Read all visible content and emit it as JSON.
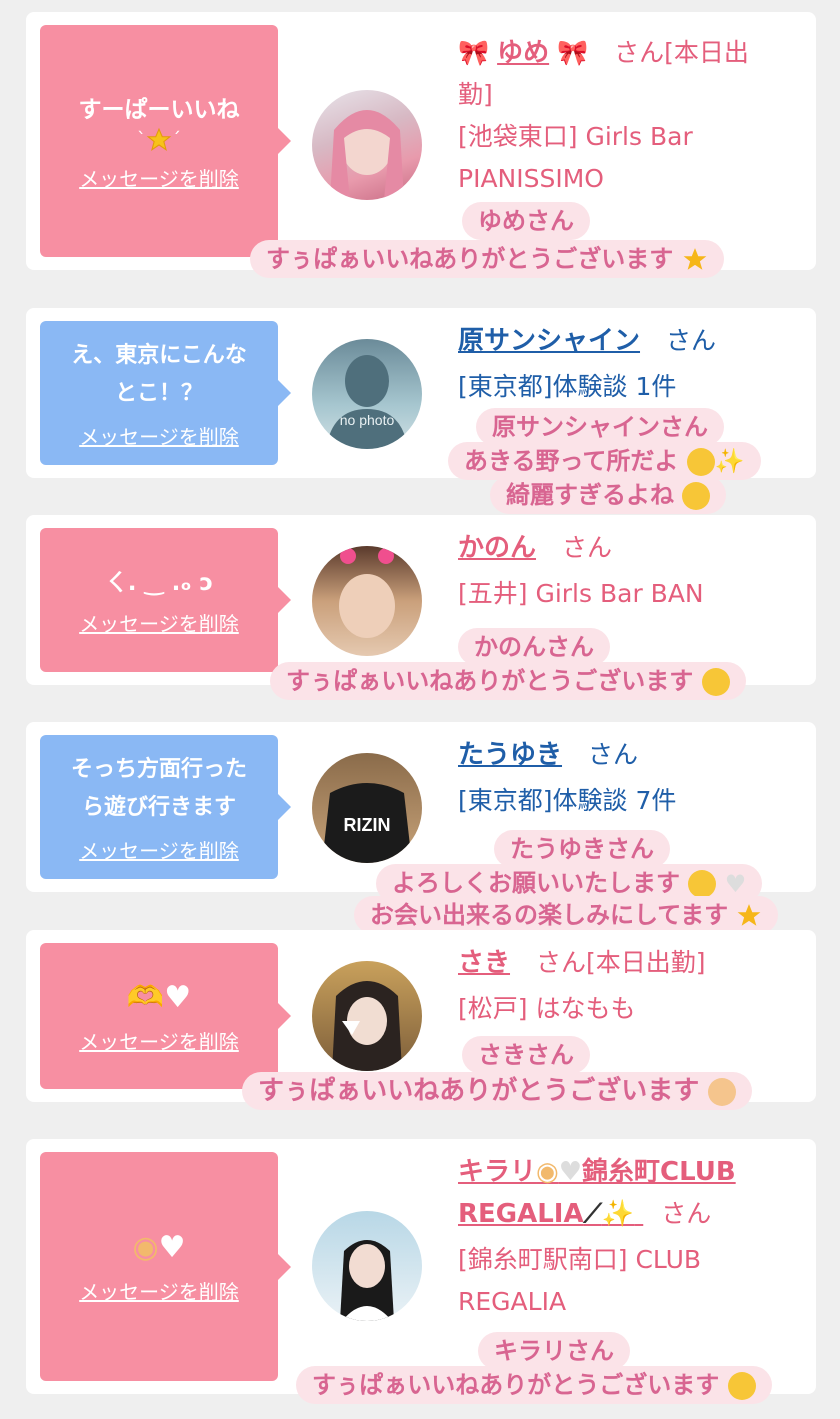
{
  "cards": [
    {
      "bubble": {
        "text": "すーぱーいいね",
        "delete_label": "メッセージを削除"
      },
      "name": "ゆめ",
      "san": "さん[本日出",
      "san2": "勤]",
      "shop1": "[池袋東口] Girls Bar",
      "shop2": "PIANISSIMO",
      "sticker_name": "ゆめさん",
      "sticker_msg": "すぅぱぁいいねありがとうございます"
    },
    {
      "bubble": {
        "text": "え、東京にこんな\nとこ！？",
        "delete_label": "メッセージを削除"
      },
      "name": "原サンシャイン",
      "san": "さん",
      "shop1": "[東京都]体験談 1件",
      "avatar_text": "no photo",
      "sticker_name": "原サンシャインさん",
      "sticker_msg1": "あきる野って所だよ",
      "sticker_msg2": "綺麗すぎるよね"
    },
    {
      "bubble": {
        "text": "ㄑ. ‿ .ₒ ↄ",
        "delete_label": "メッセージを削除"
      },
      "name": "かのん",
      "san": "さん",
      "shop1": "[五井] Girls Bar BAN",
      "sticker_name": "かのんさん",
      "sticker_msg": "すぅぱぁいいねありがとうございます"
    },
    {
      "bubble": {
        "text": "そっち方面行った\nら遊び行きます",
        "delete_label": "メッセージを削除"
      },
      "name": "たうゆき",
      "san": "さん",
      "shop1": "[東京都]体験談 7件",
      "avatar_text": "RIZIN",
      "sticker_name": "たうゆきさん",
      "sticker_msg1": "よろしくお願いいたします",
      "sticker_msg2": "お会い出来るの楽しみにしてます"
    },
    {
      "bubble": {
        "text": "",
        "delete_label": "メッセージを削除"
      },
      "name": "さき",
      "san": "さん[本日出勤]",
      "shop1": "[松戸] はなもも",
      "sticker_name": "さきさん",
      "sticker_msg": "すぅぱぁいいねありがとうございます"
    },
    {
      "bubble": {
        "text": "",
        "delete_label": "メッセージを削除"
      },
      "name1": "キラリ",
      "name1b": "錦糸町CLUB",
      "name2": "REGALIA",
      "san": "さん",
      "shop1": "[錦糸町駅南口] CLUB",
      "shop2": "REGALIA",
      "sticker_name": "キラリさん",
      "sticker_msg": "すぅぱぁいいねありがとうございます"
    }
  ],
  "colors": {
    "pink": "#f78fa2",
    "blue": "#8ab8f4",
    "link_pink": "#e45e7c",
    "link_blue": "#1f5ea8"
  }
}
